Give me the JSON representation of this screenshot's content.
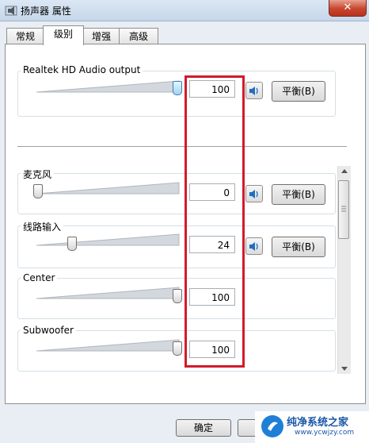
{
  "window": {
    "title": "扬声器 属性",
    "close_glyph": "✕"
  },
  "tabs": [
    {
      "label": "常规",
      "active": false
    },
    {
      "label": "级别",
      "active": true
    },
    {
      "label": "增强",
      "active": false
    },
    {
      "label": "高级",
      "active": false
    }
  ],
  "main_output": {
    "label": "Realtek HD Audio output",
    "value": "100",
    "level": 1.0,
    "balance_label": "平衡(B)",
    "speaker_icon": "speaker-icon"
  },
  "channels": [
    {
      "label": "麦克风",
      "value": "0",
      "level": 0.0,
      "balance_label": "平衡(B)",
      "has_controls": true
    },
    {
      "label": "线路输入",
      "value": "24",
      "level": 0.24,
      "balance_label": "平衡(B)",
      "has_controls": true
    },
    {
      "label": "Center",
      "value": "100",
      "level": 1.0,
      "has_controls": false
    },
    {
      "label": "Subwoofer",
      "value": "100",
      "level": 1.0,
      "has_controls": false
    }
  ],
  "footer": {
    "ok_label": "确定"
  },
  "watermark": {
    "text": "纯净系统之家",
    "url": "www.ycwjzy.com"
  },
  "colors": {
    "highlight_box": "#d11b2b",
    "speaker_blue": "#1f6fc0",
    "watermark_blue": "#1a57a8"
  }
}
